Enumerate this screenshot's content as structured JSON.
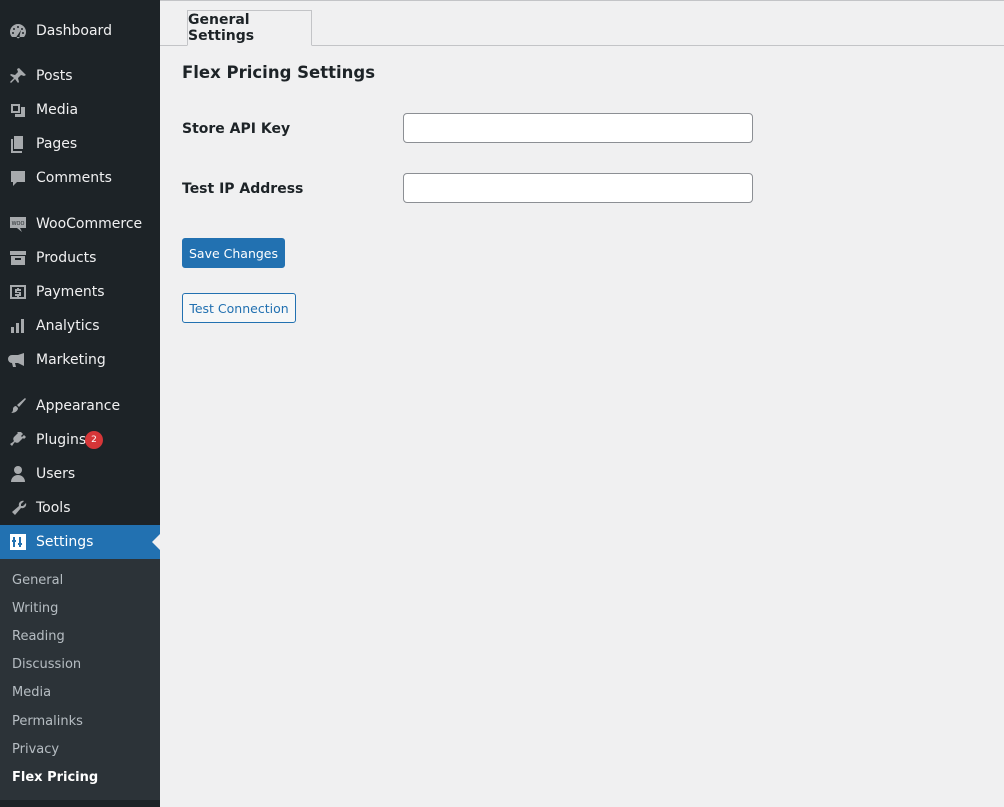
{
  "sidebar": {
    "items": [
      {
        "label": "Dashboard",
        "icon": "dashboard-icon"
      },
      {
        "label": "Posts",
        "icon": "pushpin-icon"
      },
      {
        "label": "Media",
        "icon": "media-icon"
      },
      {
        "label": "Pages",
        "icon": "pages-icon"
      },
      {
        "label": "Comments",
        "icon": "comment-icon"
      },
      {
        "label": "WooCommerce",
        "icon": "woocommerce-icon"
      },
      {
        "label": "Products",
        "icon": "archive-icon"
      },
      {
        "label": "Payments",
        "icon": "payments-icon"
      },
      {
        "label": "Analytics",
        "icon": "bar-chart-icon"
      },
      {
        "label": "Marketing",
        "icon": "megaphone-icon"
      },
      {
        "label": "Appearance",
        "icon": "paintbrush-icon"
      },
      {
        "label": "Plugins",
        "icon": "plug-icon",
        "badge": "2"
      },
      {
        "label": "Users",
        "icon": "user-icon"
      },
      {
        "label": "Tools",
        "icon": "wrench-icon"
      },
      {
        "label": "Settings",
        "icon": "settings-sliders-icon",
        "active": true
      }
    ],
    "submenu": [
      "General",
      "Writing",
      "Reading",
      "Discussion",
      "Media",
      "Permalinks",
      "Privacy",
      "Flex Pricing"
    ],
    "submenu_current": "Flex Pricing"
  },
  "tabs": [
    {
      "label": "General Settings",
      "active": true
    }
  ],
  "main": {
    "title": "Flex Pricing Settings",
    "fields": [
      {
        "label": "Store API Key",
        "value": "",
        "placeholder": ""
      },
      {
        "label": "Test IP Address",
        "value": "",
        "placeholder": ""
      }
    ],
    "save_label": "Save Changes",
    "test_label": "Test Connection"
  },
  "colors": {
    "sidebar_bg": "#1d2327",
    "submenu_bg": "#2c3338",
    "accent": "#2271b1",
    "badge": "#d63638",
    "page_bg": "#f0f0f1"
  }
}
